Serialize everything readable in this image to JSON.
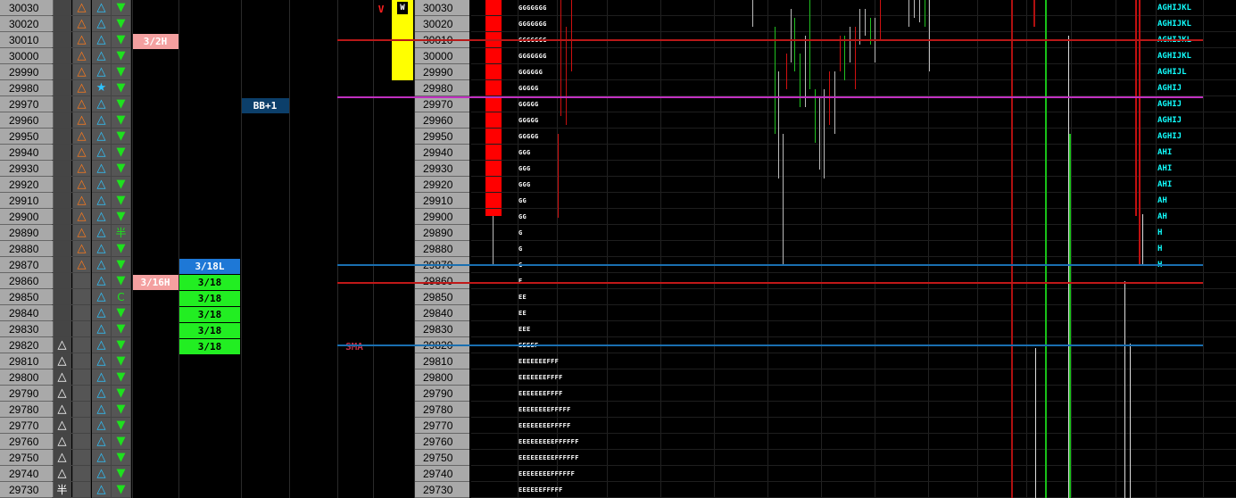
{
  "prices": [
    "30030",
    "30020",
    "30010",
    "30000",
    "29990",
    "29980",
    "29970",
    "29960",
    "29950",
    "29940",
    "29930",
    "29920",
    "29910",
    "29900",
    "29890",
    "29880",
    "29870",
    "29860",
    "29850",
    "29840",
    "29830",
    "29820",
    "29810",
    "29800",
    "29790",
    "29780",
    "29770",
    "29760",
    "29750",
    "29740",
    "29730"
  ],
  "col_a": [
    "",
    "",
    "",
    "",
    "",
    "",
    "",
    "",
    "",
    "",
    "",
    "",
    "",
    "",
    "",
    "",
    "",
    "",
    "",
    "",
    "",
    "△",
    "△",
    "△",
    "△",
    "△",
    "△",
    "△",
    "△",
    "△",
    "半"
  ],
  "col_b": [
    "△",
    "△",
    "△",
    "△",
    "△",
    "△",
    "△",
    "△",
    "△",
    "△",
    "△",
    "△",
    "△",
    "△",
    "△",
    "△",
    "△",
    "",
    "",
    "",
    "",
    "",
    "",
    "",
    "",
    "",
    "",
    "",
    "",
    "",
    ""
  ],
  "col_c": [
    "△",
    "△",
    "△",
    "△",
    "△",
    "★",
    "△",
    "△",
    "△",
    "△",
    "△",
    "△",
    "△",
    "△",
    "△",
    "△",
    "△",
    "△",
    "△",
    "△",
    "△",
    "△",
    "△",
    "△",
    "△",
    "△",
    "△",
    "△",
    "△",
    "△",
    "△"
  ],
  "col_d": [
    "▼",
    "▼",
    "▼",
    "▼",
    "▼",
    "▼",
    "▼",
    "▼",
    "▼",
    "▼",
    "▼",
    "▼",
    "▼",
    "▼",
    "半",
    "▼",
    "▼",
    "▼",
    "C",
    "▼",
    "▼",
    "▼",
    "▼",
    "▼",
    "▼",
    "▼",
    "▼",
    "▼",
    "▼",
    "▼",
    "▼"
  ],
  "tags": {
    "h_3_2": "3/2H",
    "h_3_16": "3/16H",
    "l_3_18": "3/18L",
    "d_3_18": "3/18",
    "bb": "BB+1",
    "v": "V",
    "w": "W",
    "sma": "SMA"
  },
  "tpo_left": [
    "GGGGGGG",
    "GGGGGGG",
    "GGGGGGG",
    "GGGGGGG",
    "GGGGGG",
    "GGGGG",
    "GGGGG",
    "GGGGG",
    "GGGGG",
    "GGG",
    "GGG",
    "GGG",
    "GG",
    "GG",
    "G",
    "G",
    "G",
    "E",
    "EE",
    "EE",
    "EEE",
    "EEEEF",
    "EEEEEEEFFF",
    "EEEEEEEFFFF",
    "EEEEEEEFFFF",
    "EEEEEEEEFFFFF",
    "EEEEEEEEFFFFF",
    "EEEEEEEEEFFFFFF",
    "EEEEEEEEEFFFFFF",
    "EEEEEEEEFFFFFF",
    "EEEEEEFFFFF"
  ],
  "tpo_right": [
    "AGHIJKL",
    "AGHIJKL",
    "AGHIJKL",
    "AGHIJKL",
    "AGHIJL",
    "AGHIJ",
    "AGHIJ",
    "AGHIJ",
    "AGHIJ",
    "AHI",
    "AHI",
    "AHI",
    "AH",
    "AH",
    "H",
    "H",
    "H",
    "",
    "",
    "",
    "",
    "",
    "",
    "",
    "",
    "",
    "",
    "",
    "",
    "",
    ""
  ],
  "colors": {
    "orange_triangle": "#ff7a1a",
    "cyan_triangle": "#2ec4ff",
    "green_down": "#1ee11e",
    "pink_tag": "#f4a0a0",
    "green_tag": "#22ee22",
    "blue_tag": "#1e78d6",
    "navy_tag": "#0c3f6a",
    "yellow_bar": "#ffff00",
    "red_bar": "#ff0000"
  }
}
